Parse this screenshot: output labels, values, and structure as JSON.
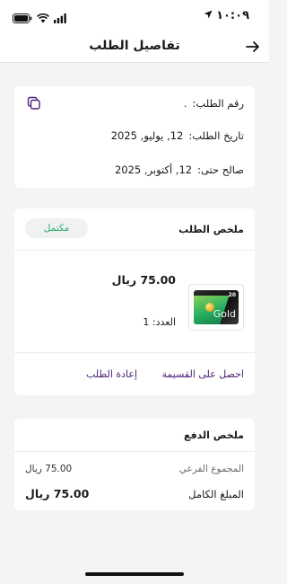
{
  "status_bar": {
    "time": "١٠:٠٩",
    "location_icon": "location-arrow-icon",
    "icons": [
      "battery-icon",
      "wifi-icon",
      "cellular-signal-icon"
    ]
  },
  "header": {
    "title": "تفاصيل الطلب",
    "back_icon": "arrow-right-icon"
  },
  "order_info": {
    "order_number_label": "رقم الطلب:",
    "order_number_value": ".",
    "order_date_label": "تاريخ الطلب:",
    "order_date_value": "12, يوليو, 2025",
    "valid_until_label": "صالح حتى:",
    "valid_until_value": "12, أكتوبر, 2025",
    "copy_icon": "copy-icon"
  },
  "order_summary": {
    "title": "ملخص الطلب",
    "status": "مكتمل",
    "status_color": "#2eaa6a",
    "product": {
      "card_amount": "20",
      "card_brand": "Gold",
      "price": "75.00 ريال",
      "quantity_label": "العدد:",
      "quantity_value": "1"
    },
    "get_value_link": "احصل على القسيمة",
    "reorder_link": "إعادة الطلب",
    "link_color": "#4b2277"
  },
  "payment_summary": {
    "title": "ملخص الدفع",
    "subtotal_label": "المجموع الفرعي",
    "subtotal_value": "75.00 ريال",
    "total_label": "المبلغ الكامل",
    "total_value": "75.00 ريال"
  }
}
